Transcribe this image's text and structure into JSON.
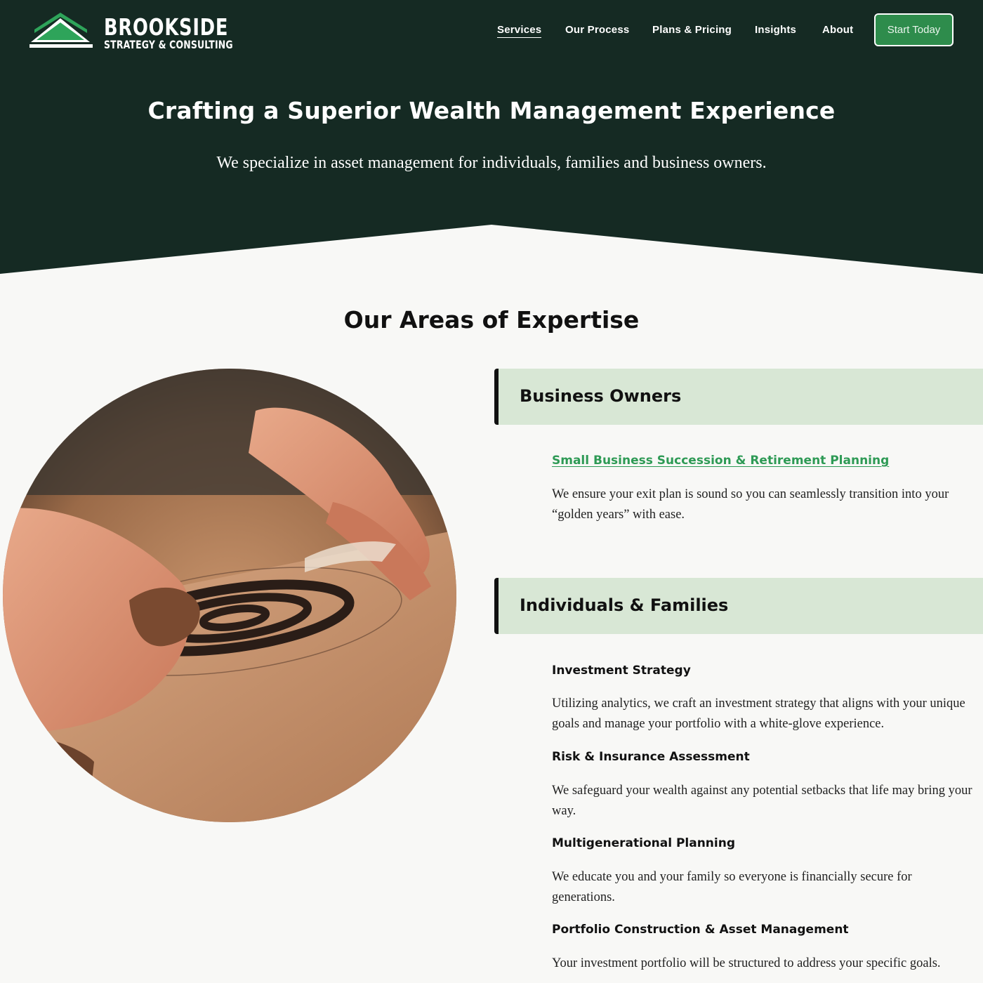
{
  "brand": {
    "name": "BROOKSIDE",
    "tagline": "STRATEGY & CONSULTING",
    "logo_icon": "mountain-roof-icon",
    "colors": {
      "dark_green": "#152a23",
      "accent_green": "#2e8c4c",
      "band_green": "#d8e7d5"
    }
  },
  "nav": {
    "items": [
      {
        "label": "Services",
        "active": true
      },
      {
        "label": "Our Process"
      },
      {
        "label": "Plans & Pricing"
      },
      {
        "label": "Insights"
      },
      {
        "label": "About"
      }
    ],
    "cta_label": "Start Today"
  },
  "hero": {
    "title": "Crafting a Superior Wealth Management Experience",
    "subtitle": "We specialize in asset management for individuals, families and business owners."
  },
  "expertise": {
    "title": "Our Areas of Expertise",
    "image": "hands-carving-wood-target-photo",
    "groups": [
      {
        "heading": "Business Owners",
        "items": [
          {
            "title": "Small Business Succession & Retirement Planning",
            "description": "We ensure your exit plan is sound so you can seamlessly transition into your “golden years” with ease."
          }
        ]
      },
      {
        "heading": "Individuals & Families",
        "items": [
          {
            "title": "Investment Strategy",
            "description": "Utilizing analytics, we craft an investment strategy that aligns with your unique goals and manage your portfolio with a white-glove experience."
          },
          {
            "title": "Risk & Insurance Assessment",
            "description": "We safeguard your wealth against any potential setbacks that life may bring your way."
          },
          {
            "title": "Multigenerational Planning",
            "description": "We educate you and your family so everyone is financially secure for generations."
          },
          {
            "title": "Portfolio Construction & Asset Management",
            "description": "Your investment portfolio will be structured to address your specific goals."
          }
        ]
      }
    ]
  }
}
